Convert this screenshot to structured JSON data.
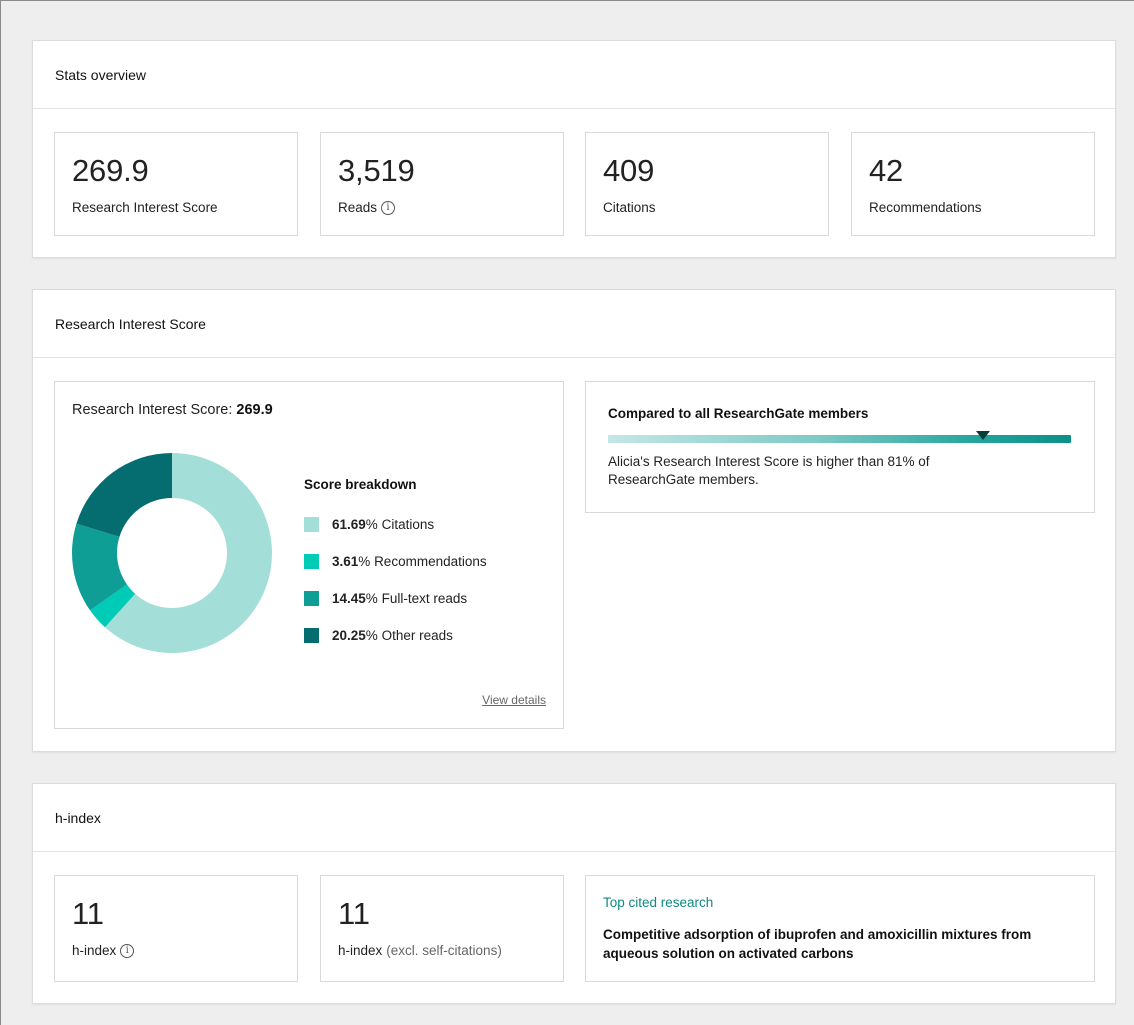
{
  "stats_overview": {
    "title": "Stats overview",
    "tiles": [
      {
        "value": "269.9",
        "label": "Research Interest Score"
      },
      {
        "value": "3,519",
        "label": "Reads"
      },
      {
        "value": "409",
        "label": "Citations"
      },
      {
        "value": "42",
        "label": "Recommendations"
      }
    ]
  },
  "research_interest": {
    "title": "Research Interest Score",
    "score_label": "Research Interest Score:",
    "score_value": "269.9",
    "breakdown_title": "Score breakdown",
    "breakdown": [
      {
        "pct": "61.69",
        "label": "Citations",
        "color": "#a3dfd8"
      },
      {
        "pct": "3.61",
        "label": "Recommendations",
        "color": "#00cbb6"
      },
      {
        "pct": "14.45",
        "label": "Full-text reads",
        "color": "#0f9e96"
      },
      {
        "pct": "20.25",
        "label": "Other reads",
        "color": "#056c70"
      }
    ],
    "pct_suffix": "%",
    "view_details": "View details",
    "comparison": {
      "title": "Compared to all ResearchGate members",
      "text": "Alicia's Research Interest Score is higher than 81% of ResearchGate members.",
      "percentile": 81
    }
  },
  "chart_data": {
    "type": "pie",
    "title": "",
    "categories": [
      "Citations",
      "Recommendations",
      "Full-text reads",
      "Other reads"
    ],
    "values": [
      61.69,
      3.61,
      14.45,
      20.25
    ],
    "colors": [
      "#a3dfd8",
      "#00cbb6",
      "#0f9e96",
      "#056c70"
    ],
    "donut": true
  },
  "h_index": {
    "title": "h-index",
    "tiles": [
      {
        "value": "11",
        "label": "h-index",
        "suffix": ""
      },
      {
        "value": "11",
        "label": "h-index",
        "suffix": "(excl. self-citations)"
      }
    ],
    "top_cited_label": "Top cited research",
    "top_cited_title": "Competitive adsorption of ibuprofen and amoxicillin mixtures from aqueous solution on activated carbons"
  },
  "icons": {
    "info": "info-icon"
  }
}
